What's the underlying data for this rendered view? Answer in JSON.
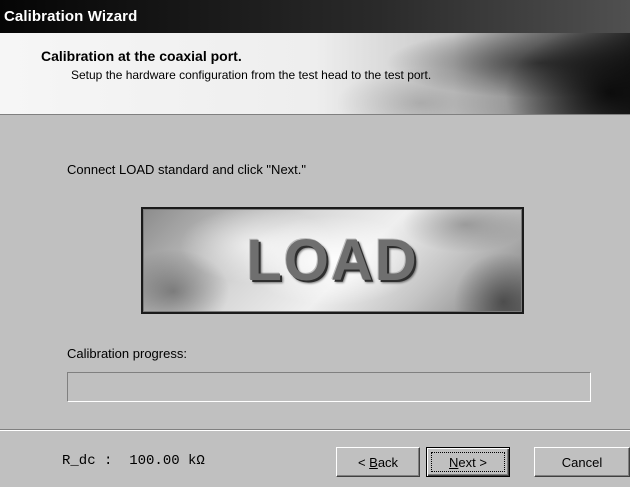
{
  "window": {
    "title": "Calibration Wizard"
  },
  "header": {
    "title": "Calibration at the coaxial port.",
    "subtitle": "Setup the hardware configuration from the test head to the test port."
  },
  "main": {
    "instruction": "Connect LOAD standard and click \"Next.\"",
    "standard_image_label": "LOAD",
    "progress_label": "Calibration progress:",
    "progress_value": 0
  },
  "footer": {
    "readout": "R_dc :  100.00 kΩ",
    "back_prefix": "< ",
    "back_mnemonic": "B",
    "back_rest": "ack",
    "next_mnemonic": "N",
    "next_rest": "ext >",
    "cancel_label": "Cancel"
  }
}
